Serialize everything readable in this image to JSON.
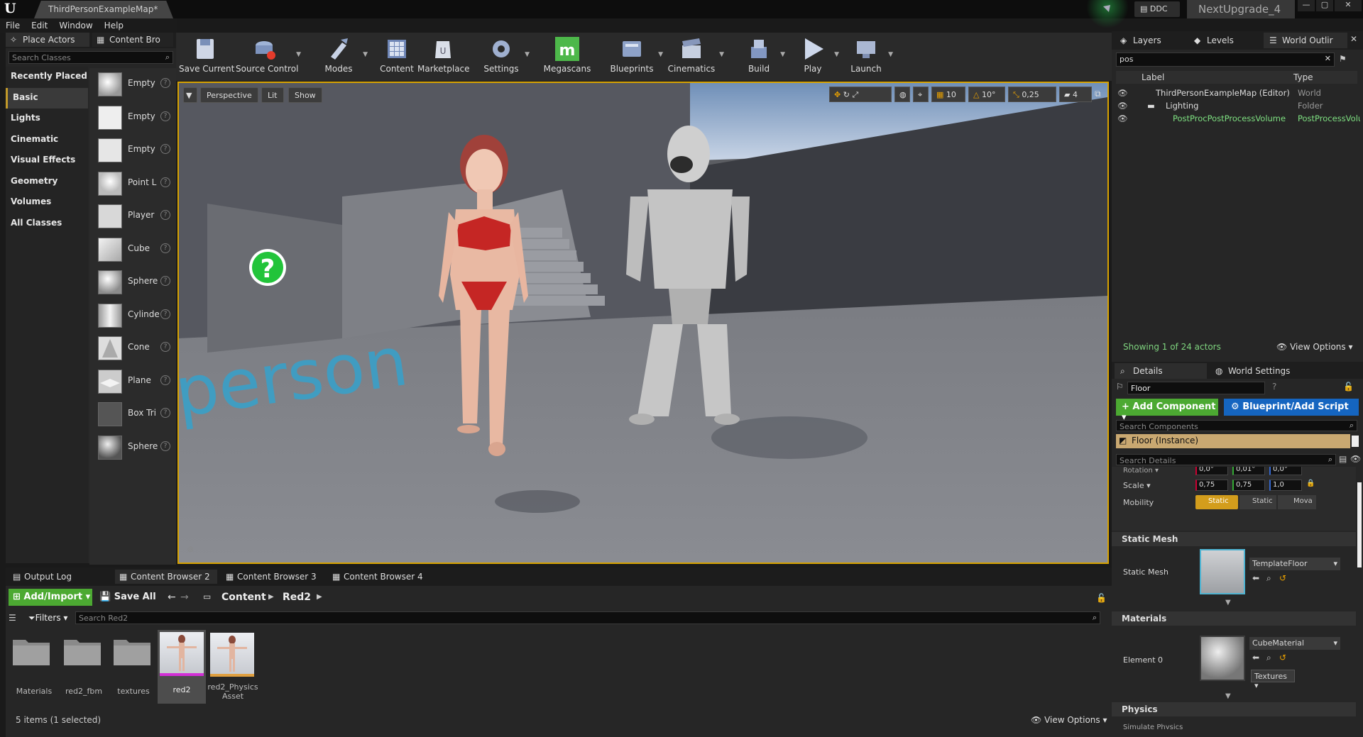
{
  "window": {
    "doc_tab": "ThirdPersonExampleMap*",
    "ddc_label": "DDC",
    "project_name": "NextUpgrade_4",
    "min": "—",
    "max": "▢",
    "close": "✕"
  },
  "menu": [
    "File",
    "Edit",
    "Window",
    "Help"
  ],
  "left_panel": {
    "tab_place": "Place Actors",
    "tab_content": "Content Bro",
    "search_placeholder": "Search Classes",
    "categories": [
      "Recently Placed",
      "Basic",
      "Lights",
      "Cinematic",
      "Visual Effects",
      "Geometry",
      "Volumes",
      "All Classes"
    ],
    "selected_category": "Basic",
    "actors": [
      "Empty",
      "Empty",
      "Empty",
      "Point L",
      "Player",
      "Cube",
      "Sphere",
      "Cylinde",
      "Cone",
      "Plane",
      "Box Tri",
      "Sphere"
    ]
  },
  "toolbar": {
    "items": [
      "Save Current",
      "Source Control",
      "Modes",
      "Content",
      "Marketplace",
      "Settings",
      "Megascans",
      "Blueprints",
      "Cinematics",
      "Build",
      "Play",
      "Launch"
    ]
  },
  "viewport": {
    "perspective": "Perspective",
    "lit": "Lit",
    "show": "Show",
    "grid_snap": "10",
    "rot_snap": "10°",
    "scale_snap": "0,25",
    "cam_speed": "4",
    "floor_text": "person",
    "help_glyph": "?"
  },
  "outliner": {
    "tab_layers": "Layers",
    "tab_levels": "Levels",
    "tab_world": "World Outlir",
    "search_value": "pos",
    "col_label": "Label",
    "col_type": "Type",
    "rows": [
      {
        "label": "ThirdPersonExampleMap (Editor)",
        "type": "World"
      },
      {
        "label": "Lighting",
        "type": "Folder"
      },
      {
        "label": "PostProcPostProcessVolume",
        "type": "PostProcessVolu"
      }
    ],
    "status": "Showing 1 of 24 actors",
    "view_options": "View Options"
  },
  "details": {
    "tab_details": "Details",
    "tab_world_settings": "World Settings",
    "name_value": "Floor",
    "add_component": "+ Add Component",
    "blueprint": "Blueprint/Add Script",
    "search_components": "Search Components",
    "instance": "Floor (Instance)",
    "search_details": "Search Details",
    "rotation_label": "Rotation",
    "rotation": [
      "0,0°",
      "0,01°",
      "0,0°"
    ],
    "scale_label": "Scale",
    "scale": [
      "0,75",
      "0,75",
      "1,0"
    ],
    "mobility_label": "Mobility",
    "mobility": [
      "Static",
      "Static",
      "Mova"
    ],
    "section_static_mesh": "Static Mesh",
    "static_mesh_label": "Static Mesh",
    "static_mesh_value": "TemplateFloor",
    "section_materials": "Materials",
    "element0_label": "Element 0",
    "material_value": "CubeMaterial",
    "textures_btn": "Textures",
    "section_physics": "Physics",
    "simulate_physics": "Simulate Physics"
  },
  "bottom": {
    "tabs": [
      "Output Log",
      "Content Browser 2",
      "Content Browser 3",
      "Content Browser 4"
    ],
    "add_import": "Add/Import",
    "save_all": "Save All",
    "path": [
      "Content",
      "Red2"
    ],
    "filters": "Filters",
    "search_placeholder": "Search Red2",
    "assets": [
      {
        "name": "Materials",
        "kind": "folder"
      },
      {
        "name": "red2_fbm",
        "kind": "folder"
      },
      {
        "name": "textures",
        "kind": "folder"
      },
      {
        "name": "red2",
        "kind": "mesh"
      },
      {
        "name": "red2_Physics Asset",
        "kind": "physics"
      }
    ],
    "status": "5 items (1 selected)",
    "view_options": "View Options"
  },
  "colors": {
    "accent_orange": "#d7a200",
    "add_green": "#4ca932",
    "blueprint_blue": "#1565c0",
    "selection_bar": "#c29a2a"
  }
}
